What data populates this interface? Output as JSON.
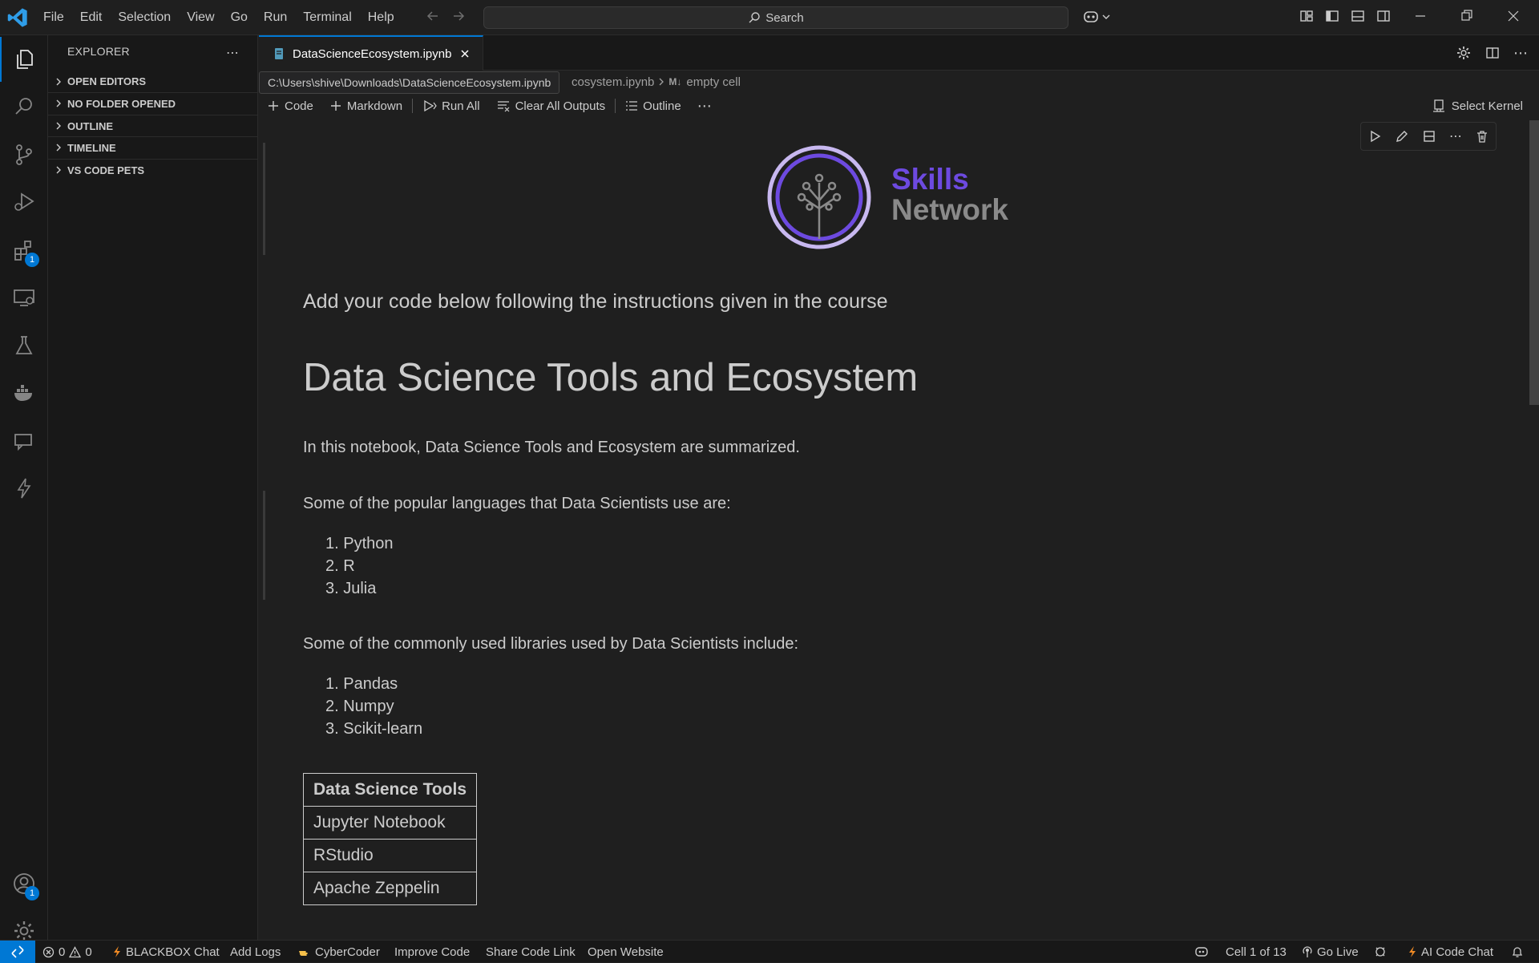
{
  "menu": [
    "File",
    "Edit",
    "Selection",
    "View",
    "Go",
    "Run",
    "Terminal",
    "Help"
  ],
  "search": {
    "label": "Search"
  },
  "sidebar": {
    "title": "EXPLORER",
    "sections": [
      "OPEN EDITORS",
      "NO FOLDER OPENED",
      "OUTLINE",
      "TIMELINE",
      "VS CODE PETS"
    ]
  },
  "activity": {
    "extensions_badge": "1",
    "accounts_badge": "1"
  },
  "tab": {
    "name": "DataScienceEcosystem.ipynb"
  },
  "tooltip": {
    "path": "C:\\Users\\shive\\Downloads\\DataScienceEcosystem.ipynb"
  },
  "breadcrumb": {
    "file_tail": "cosystem.ipynb",
    "cell": "empty cell",
    "md_icon": "M↓"
  },
  "toolbar": {
    "code": "Code",
    "markdown": "Markdown",
    "run_all": "Run All",
    "clear_outputs": "Clear All Outputs",
    "outline": "Outline",
    "kernel": "Select Kernel"
  },
  "notebook": {
    "logo_top": "Skills",
    "logo_bottom": "Network",
    "instructions": "Add your code below following the instructions given in the course",
    "title": "Data Science Tools and Ecosystem",
    "intro": "In this notebook, Data Science Tools and Ecosystem are summarized.",
    "languages_intro": "Some of the popular languages that Data Scientists use are:",
    "languages": [
      "1. Python",
      "2. R",
      "3. Julia"
    ],
    "libraries_intro": "Some of the commonly used libraries used by Data Scientists include:",
    "libraries": [
      "1. Pandas",
      "2. Numpy",
      "3. Scikit-learn"
    ],
    "tools_header": "Data Science Tools",
    "tools": [
      "Jupyter Notebook",
      "RStudio",
      "Apache Zeppelin"
    ]
  },
  "status": {
    "errors": "0",
    "warnings": "0",
    "blackbox": "BLACKBOX Chat",
    "add_logs": "Add Logs",
    "cybercoder": "CyberCoder",
    "improve": "Improve Code",
    "share": "Share Code Link",
    "website": "Open Website",
    "cell": "Cell 1 of 13",
    "golive": "Go Live",
    "ai_chat": "AI Code Chat"
  },
  "colors": {
    "accent": "#0078d4",
    "skills_purple": "#6d4ae0",
    "logo_ring": "#c8b8f0"
  }
}
